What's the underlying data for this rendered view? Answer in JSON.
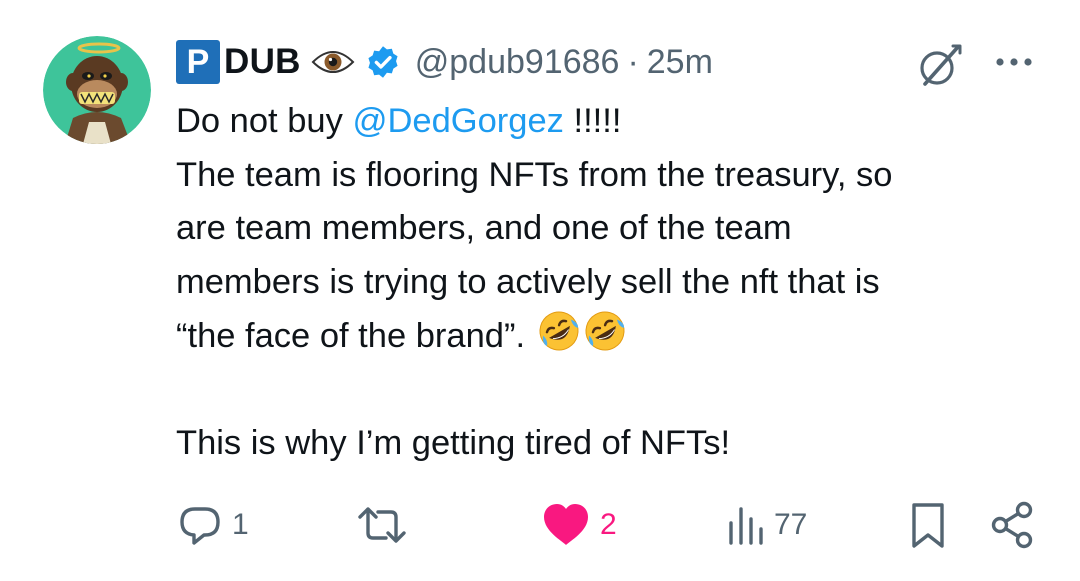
{
  "author": {
    "badge_letter": "P",
    "name": "DUB",
    "handle": "@pdub91686",
    "separator": "·",
    "time": "25m",
    "verified": true,
    "name_emoji": "eye-icon"
  },
  "tweet": {
    "line1_prefix": "Do not buy ",
    "mention": "@DedGorgez",
    "line1_suffix": " !!!!!",
    "line2": "The team is flooring NFTs from the treasury, so",
    "line3": "are team members, and one of the team",
    "line4": "members is trying to actively sell the nft that is",
    "line5": "“the face of the brand”.",
    "line5_emojis": [
      "rolling-on-floor-laughing-icon",
      "rolling-on-floor-laughing-icon"
    ],
    "line7": "This is why I’m getting tired of NFTs!"
  },
  "actions": {
    "replies": "1",
    "likes": "2",
    "views": "77",
    "liked": true
  },
  "colors": {
    "accent": "#1d9bf0",
    "like": "#f91880",
    "secondary_text": "#536471",
    "avatar_bg": "#3ec49a",
    "badge_bg": "#1f6fb8"
  }
}
